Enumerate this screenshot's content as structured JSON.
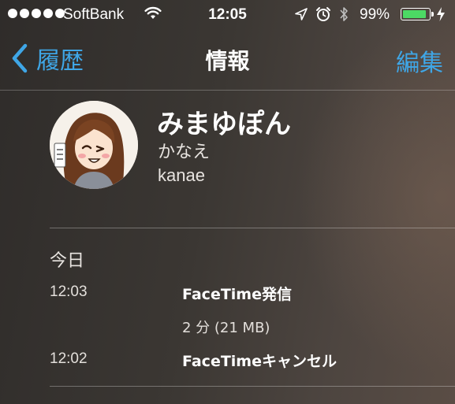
{
  "status_bar": {
    "carrier": "SoftBank",
    "time": "12:05",
    "battery_percent": "99%",
    "battery_level": 0.99,
    "signal_bars": 5,
    "battery_color": "#4cd964"
  },
  "nav": {
    "back_label": "履歴",
    "title": "情報",
    "edit_label": "編集",
    "accent_color": "#3fa6e6"
  },
  "contact": {
    "name": "みまゆぽん",
    "subtitle_1": "かなえ",
    "subtitle_2": "kanae"
  },
  "history": {
    "section_title": "今日",
    "entries": [
      {
        "time": "12:03",
        "type": "FaceTime発信",
        "detail": "2 分 (21 MB)"
      },
      {
        "time": "12:02",
        "type": "FaceTimeキャンセル",
        "detail": ""
      }
    ]
  }
}
